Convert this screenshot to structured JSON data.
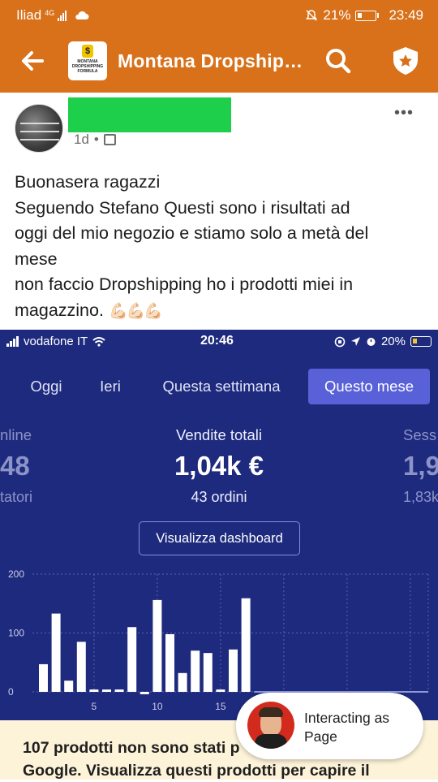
{
  "status_bar": {
    "carrier": "Iliad",
    "network": "4G",
    "battery": "21%",
    "time": "23:49"
  },
  "app_bar": {
    "title": "Montana Dropship…",
    "logo_text": "MONTANA DROPSHIPPING FORMULA",
    "logo_mark": "$",
    "icons": [
      "back-arrow-icon",
      "search-icon",
      "shield-star-icon"
    ]
  },
  "post": {
    "time": "1d",
    "separator": "•",
    "lines": [
      "Buonasera ragazzi",
      "Seguendo Stefano  Questi sono i risultati ad",
      "oggi del mio negozio e stiamo solo a metà del",
      "mese",
      "non faccio Dropshipping ho i prodotti miei in",
      "magazzino."
    ],
    "emoji": "💪🏻💪🏻💪🏻",
    "more": "•••"
  },
  "screenshot": {
    "status": {
      "carrier": "vodafone IT",
      "time": "20:46",
      "battery": "20%"
    },
    "tabs": [
      "Oggi",
      "Ieri",
      "Questa settimana",
      "Questo mese"
    ],
    "active_tab": "Questo mese",
    "kpi": {
      "left_label": "nline",
      "left_value": "48",
      "left_sub": "tatori",
      "center_label": "Vendite totali",
      "center_value": "1,04k €",
      "center_sub": "43 ordini",
      "right_label": "Sess",
      "right_value": "1,9",
      "right_sub": "1,83k"
    },
    "dashboard_button": "Visualizza dashboard"
  },
  "chart_data": {
    "type": "bar",
    "title": "",
    "xlabel": "",
    "ylabel": "",
    "ylim": [
      0,
      200
    ],
    "y_ticks": [
      "0",
      "100",
      "200"
    ],
    "x_ticks": [
      "5",
      "10",
      "15"
    ],
    "grid": true,
    "x": [
      1,
      2,
      3,
      4,
      5,
      6,
      7,
      8,
      9,
      10,
      11,
      12,
      13,
      14,
      15,
      16,
      17
    ],
    "values": [
      47,
      133,
      19,
      85,
      4,
      4,
      4,
      110,
      -4,
      156,
      98,
      32,
      70,
      66,
      4,
      72,
      159
    ],
    "bar_color": "#ffffff",
    "background": "#1e2a7d"
  },
  "banner": {
    "lines": [
      "107 prodotti non sono stati p",
      "Google. Visualizza questi prodotti per capire il"
    ]
  },
  "interacting": {
    "label": "Interacting as Page"
  }
}
